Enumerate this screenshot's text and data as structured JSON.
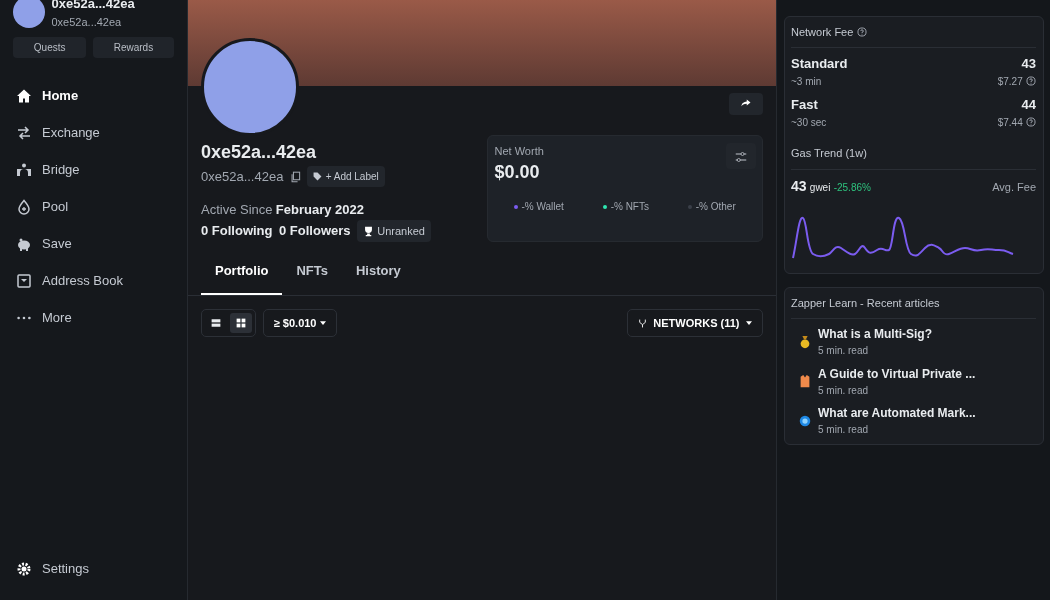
{
  "account": {
    "name": "0xe52a...42ea",
    "address": "0xe52a...42ea"
  },
  "sidebar_buttons": [
    "Quests",
    "Rewards"
  ],
  "sidebar": {
    "items": [
      {
        "label": "Home",
        "kind": "home",
        "selected": true
      },
      {
        "label": "Exchange",
        "kind": "exchange",
        "selected": false
      },
      {
        "label": "Bridge",
        "kind": "bridge",
        "selected": false
      },
      {
        "label": "Pool",
        "kind": "pool",
        "selected": false
      },
      {
        "label": "Save",
        "kind": "save",
        "selected": false
      },
      {
        "label": "Address Book",
        "kind": "book",
        "selected": false
      },
      {
        "label": "More",
        "kind": "more",
        "selected": false
      }
    ],
    "settings": "Settings"
  },
  "profile": {
    "name": "0xe52a...42ea",
    "address": "0xe52a...42ea",
    "add_label": "+ Add Label",
    "active_since_label": "Active Since",
    "active_since": "February 2022",
    "following": "0 Following",
    "followers": "0 Followers",
    "rank": "Unranked"
  },
  "net_worth": {
    "label": "Net Worth",
    "value": "$0.00",
    "legend": [
      {
        "label": "-% Wallet",
        "color": "#7b5cf0"
      },
      {
        "label": "-% NFTs",
        "color": "#2ee6b0"
      },
      {
        "label": "-% Other",
        "color": "#3a3f48"
      }
    ]
  },
  "tabs": [
    {
      "label": "Portfolio",
      "selected": true
    },
    {
      "label": "NFTs",
      "selected": false
    },
    {
      "label": "History",
      "selected": false
    }
  ],
  "toolbar": {
    "views": [
      {
        "kind": "list",
        "selected": false
      },
      {
        "kind": "grid",
        "selected": true
      }
    ],
    "min_value": "≥ $0.010",
    "networks": "NETWORKS (11)"
  },
  "network_fee": {
    "title": "Network Fee",
    "tiers": [
      {
        "name": "Standard",
        "time": "~3 min",
        "gwei": "43",
        "usd": "$7.27"
      },
      {
        "name": "Fast",
        "time": "~30 sec",
        "gwei": "44",
        "usd": "$7.44"
      }
    ],
    "trend_title": "Gas Trend (1w)",
    "current": "43",
    "unit": "gwei",
    "change": "-25.86%",
    "avg_label": "Avg. Fee"
  },
  "learn": {
    "title": "Zapper Learn - Recent articles",
    "articles": [
      {
        "title": "What is a Multi-Sig?",
        "read": "5 min. read",
        "kind": "medal"
      },
      {
        "title": "A Guide to Virtual Private ...",
        "read": "5 min. read",
        "kind": "vest"
      },
      {
        "title": "What are Automated Mark...",
        "read": "5 min. read",
        "kind": "orb"
      }
    ]
  }
}
